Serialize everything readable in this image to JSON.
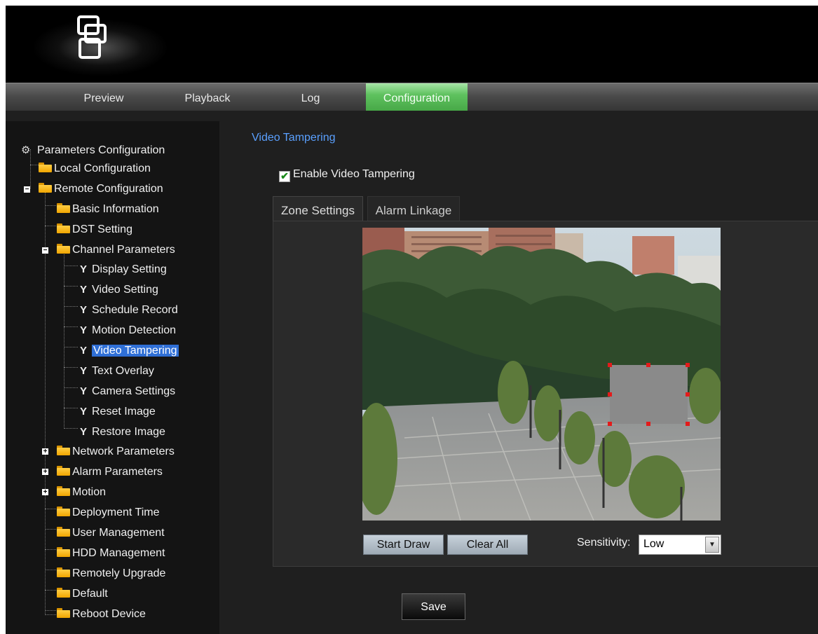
{
  "nav": {
    "items": [
      "Preview",
      "Playback",
      "Log",
      "Configuration"
    ],
    "active": "Configuration"
  },
  "tree": {
    "root": "Parameters Configuration",
    "local": "Local Configuration",
    "remote": "Remote Configuration",
    "basic_information": "Basic Information",
    "dst_setting": "DST Setting",
    "channel_parameters": "Channel Parameters",
    "channel_items": [
      "Display Setting",
      "Video Setting",
      "Schedule Record",
      "Motion Detection",
      "Video Tampering",
      "Text Overlay",
      "Camera Settings",
      "Reset Image",
      "Restore Image"
    ],
    "network_parameters": "Network Parameters",
    "alarm_parameters": "Alarm Parameters",
    "motion": "Motion",
    "deployment_time": "Deployment Time",
    "user_management": "User Management",
    "hdd_management": "HDD Management",
    "remotely_upgrade": "Remotely Upgrade",
    "default": "Default",
    "reboot_device": "Reboot Device",
    "selected": "Video Tampering"
  },
  "main": {
    "title": "Video Tampering",
    "enable_label": "Enable Video Tampering",
    "enable_checked": true,
    "tabs": [
      "Zone Settings",
      "Alarm Linkage"
    ],
    "active_tab": "Zone Settings",
    "start_draw": "Start Draw",
    "clear_all": "Clear All",
    "sensitivity_label": "Sensitivity:",
    "sensitivity_value": "Low",
    "save": "Save"
  },
  "colors": {
    "active_tab_green": "#5fc25f",
    "title_blue": "#5aa0ff",
    "selection_blue": "#2f6fd6",
    "zone_handle_red": "#e31b1b"
  },
  "icons": [
    "logo-icon",
    "folder-icon",
    "wrench-icon",
    "expand-icon",
    "collapse-icon",
    "dropdown-arrow-icon",
    "checkmark-icon"
  ]
}
